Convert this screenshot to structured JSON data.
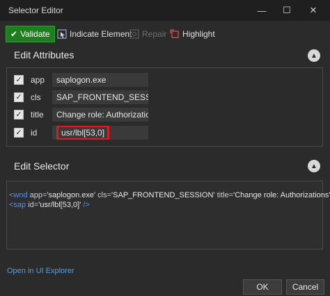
{
  "window": {
    "title": "Selector Editor"
  },
  "toolbar": {
    "validate": "Validate",
    "indicate": "Indicate Element",
    "repair": "Repair",
    "highlight": "Highlight"
  },
  "attributes": {
    "title": "Edit Attributes",
    "rows": [
      {
        "checked": true,
        "name": "app",
        "value": "saplogon.exe"
      },
      {
        "checked": true,
        "name": "cls",
        "value": "SAP_FRONTEND_SESSION"
      },
      {
        "checked": true,
        "name": "title",
        "value": "Change role: Authorizations"
      },
      {
        "checked": true,
        "name": "id",
        "value": "usr/lbl[53,0]"
      }
    ]
  },
  "selector": {
    "title": "Edit Selector",
    "line1": {
      "open": "<wnd",
      "a1": "app=",
      "v1": "'saplogon.exe'",
      "a2": "cls=",
      "v2": "'SAP_FRONTEND_SESSION'",
      "a3": "title=",
      "v3": "'Change role: Authorizations'",
      "close": "/>"
    },
    "line2": {
      "open": "<sap",
      "a1": "id=",
      "v1": "'usr/lbl[53,0]'",
      "close": "/>"
    }
  },
  "footer": {
    "link": "Open in UI Explorer",
    "ok": "OK",
    "cancel": "Cancel"
  },
  "colors": {
    "validate_bg": "#1e7e1e",
    "highlight_border": "#e01b1b",
    "link": "#4aa3e8",
    "tag": "#5b8fe0"
  },
  "icons": {
    "minimize": "minimize-icon",
    "maximize": "maximize-icon",
    "close": "close-icon",
    "validate": "checkmark-icon",
    "indicate": "target-icon",
    "repair": "repair-icon",
    "highlight": "highlight-icon",
    "collapse": "chevron-up-icon"
  }
}
